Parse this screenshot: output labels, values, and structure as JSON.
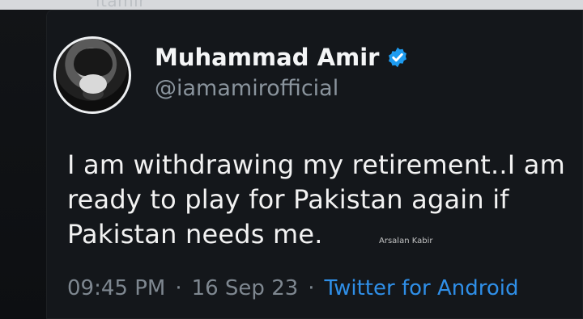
{
  "page": {
    "top_ghost_text": "itamir"
  },
  "tweet": {
    "display_name": "Muhammad Amir",
    "handle": "@iamamirofficial",
    "verified": true,
    "text_lines": [
      "I am withdrawing my retirement..I am",
      "ready to play for Pakistan again if",
      "Pakistan needs me."
    ],
    "watermark": "Arsalan Kabir",
    "time": "09:45 PM",
    "separator": "·",
    "date": "16 Sep 23",
    "source": "Twitter for Android"
  },
  "colors": {
    "background": "#121417",
    "text_primary": "#f4f5f6",
    "text_secondary": "#8a949d",
    "verified_blue": "#1d9bf0",
    "source_blue": "#2f8fe8"
  },
  "icons": {
    "verified": "verified-icon"
  }
}
